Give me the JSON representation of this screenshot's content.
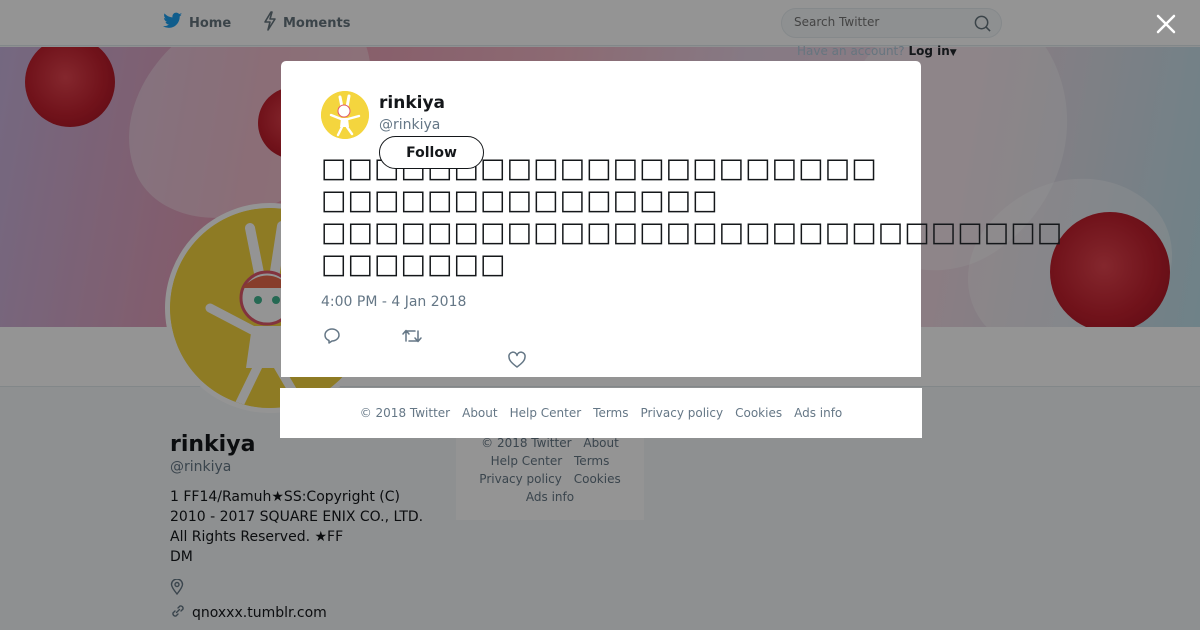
{
  "colors": {
    "twitter_blue": "#1da1f2",
    "text_primary": "#14171a",
    "text_secondary": "#657786",
    "avatar_yellow": "#f4d53e"
  },
  "nav": {
    "home_label": "Home",
    "moments_label": "Moments",
    "search_placeholder": "Search Twitter",
    "account_prompt": "Have an account?",
    "login_label": "Log in"
  },
  "icons": {
    "logo": "twitter-bird-icon",
    "moments": "lightning-icon",
    "search": "search-icon",
    "close": "close-icon",
    "reply": "reply-icon",
    "retweet": "retweet-icon",
    "like": "heart-icon",
    "location": "location-pin-icon",
    "link": "link-icon"
  },
  "profile": {
    "name": "rinkiya",
    "handle": "@rinkiya",
    "bio": "1 FF14/Ramuh★SS:Copyright (C)\n2010 - 2017 SQUARE ENIX CO., LTD.\nAll Rights Reserved. ★FF\nDM",
    "url": "qnoxxx.tumblr.com"
  },
  "side_footer": {
    "copyright": "© 2018 Twitter",
    "about": "About",
    "help": "Help Center",
    "terms": "Terms",
    "privacy": "Privacy policy",
    "cookies": "Cookies",
    "ads": "Ads info"
  },
  "tweet": {
    "author_name": "rinkiya",
    "author_handle": "@rinkiya",
    "follow_label": "Follow",
    "text_lines": [
      "□□□□□□□□□□□□□□□□□□□□□",
      "□□□□□□□□□□□□□□□",
      "□□□□□□□□□□□□□□□□□□□□□□□□□□□□",
      "□□□□□□□"
    ],
    "timestamp": "4:00 PM - 4 Jan 2018"
  },
  "modal_footer": {
    "copyright": "© 2018 Twitter",
    "about": "About",
    "help": "Help Center",
    "terms": "Terms",
    "privacy": "Privacy policy",
    "cookies": "Cookies",
    "ads": "Ads info"
  }
}
